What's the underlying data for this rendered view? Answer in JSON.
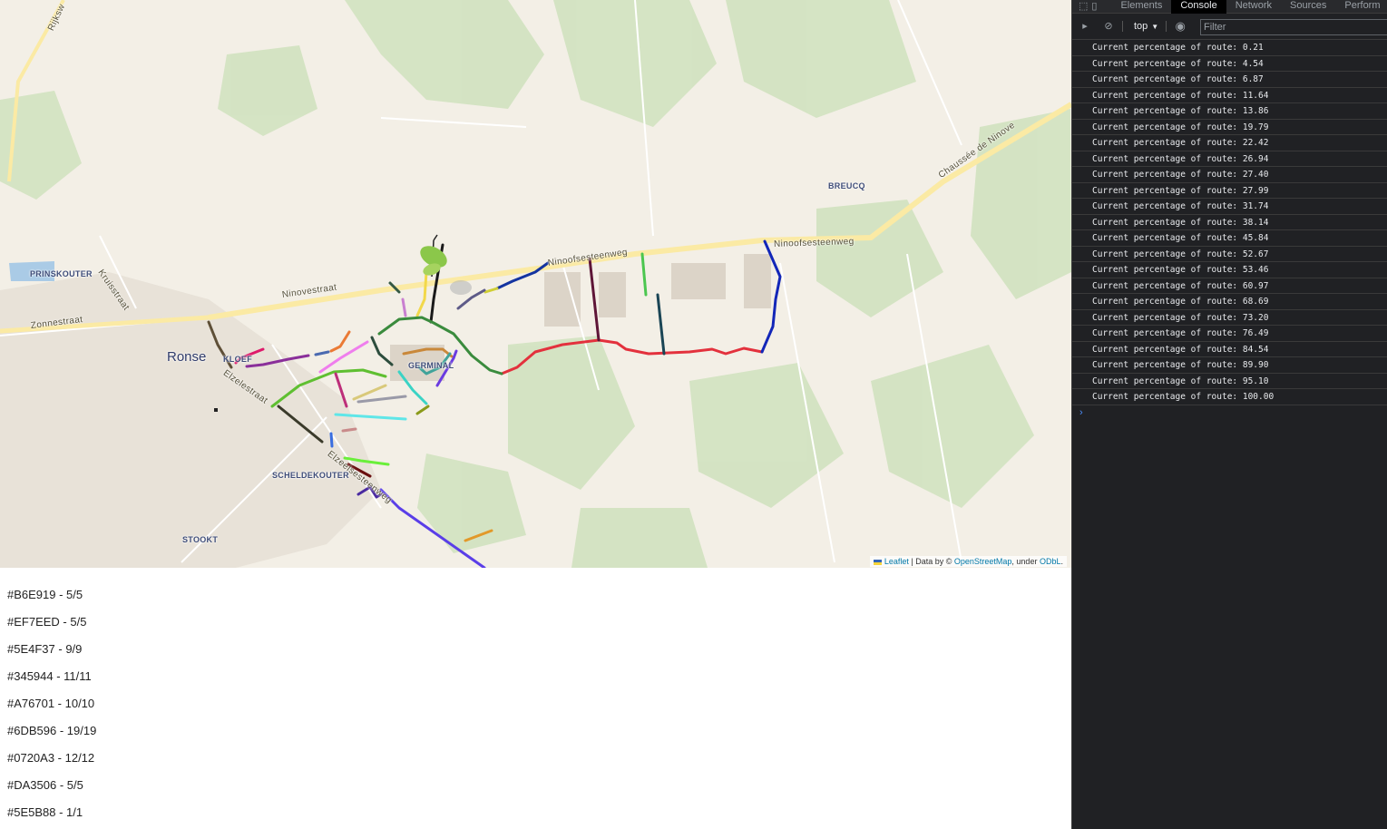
{
  "map": {
    "places": [
      {
        "name": "Ronse"
      },
      {
        "name": "PRINSKOUTER"
      },
      {
        "name": "KLOEF"
      },
      {
        "name": "GERMINAL"
      },
      {
        "name": "SCHELDEKOUTER"
      },
      {
        "name": "STOOKT"
      },
      {
        "name": "BREUCQ"
      }
    ],
    "roads": [
      {
        "name": "Ninovestraat"
      },
      {
        "name": "Ninoofsesteenweg"
      },
      {
        "name": "Ninoofsesteenweg"
      },
      {
        "name": "Zonnestraat"
      },
      {
        "name": "Kruisstraat"
      },
      {
        "name": "Chaussée de Ninove"
      },
      {
        "name": "Rijksw"
      },
      {
        "name": "Elzelestraat"
      },
      {
        "name": "Elzeelsesteenweg"
      }
    ],
    "attribution": {
      "leaflet": "Leaflet",
      "text1": "| Data by ©",
      "osm": "OpenStreetMap",
      "text2": ", under",
      "odbl": "ODbL",
      "text3": "."
    }
  },
  "route_stats": [
    "#B6E919 - 5/5",
    "#EF7EED - 5/5",
    "#5E4F37 - 9/9",
    "#345944 - 11/11",
    "#A76701 - 10/10",
    "#6DB596 - 19/19",
    "#0720A3 - 12/12",
    "#DA3506 - 5/5",
    "#5E5B88 - 1/1"
  ],
  "devtools": {
    "tabs": [
      "Elements",
      "Console",
      "Network",
      "Sources",
      "Perform"
    ],
    "active_tab": "Console",
    "context": "top",
    "filter_placeholder": "Filter",
    "logs": [
      "Current percentage of route: 0.21",
      "Current percentage of route: 4.54",
      "Current percentage of route: 6.87",
      "Current percentage of route: 11.64",
      "Current percentage of route: 13.86",
      "Current percentage of route: 19.79",
      "Current percentage of route: 22.42",
      "Current percentage of route: 26.94",
      "Current percentage of route: 27.40",
      "Current percentage of route: 27.99",
      "Current percentage of route: 31.74",
      "Current percentage of route: 38.14",
      "Current percentage of route: 45.84",
      "Current percentage of route: 52.67",
      "Current percentage of route: 53.46",
      "Current percentage of route: 60.97",
      "Current percentage of route: 68.69",
      "Current percentage of route: 73.20",
      "Current percentage of route: 76.49",
      "Current percentage of route: 84.54",
      "Current percentage of route: 89.90",
      "Current percentage of route: 95.10",
      "Current percentage of route: 100.00"
    ],
    "prompt": "›"
  }
}
